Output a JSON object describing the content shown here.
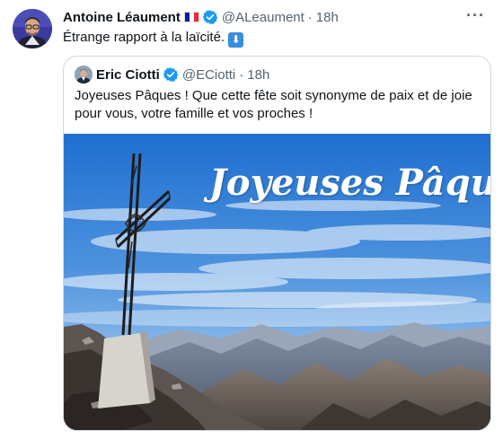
{
  "tweet": {
    "author_name": "Antoine Léaument",
    "author_handle": "@ALeaument",
    "separator": "·",
    "time": "18h",
    "text": "Étrange rapport à la laïcité.",
    "more_label": "···",
    "avatar_icon": "avatar-man-glasses",
    "flag_icon": "flag-france",
    "verified_icon": "verified-badge",
    "emoji_icon": "down-arrow-emoji",
    "emoji_glyph": "⬇"
  },
  "quote": {
    "author_name": "Eric Ciotti",
    "author_handle": "@ECiotti",
    "separator": "·",
    "time": "18h",
    "text": "Joyeuses Pâques ! Que cette fête soit synonyme de paix et de joie pour vous, votre famille et vos proches !",
    "avatar_icon": "avatar-man-suit",
    "verified_icon": "verified-badge",
    "media": {
      "overlay_text": "Joyeuses Pâques !",
      "description_icon": "mountain-cross-photo"
    }
  },
  "colors": {
    "verified_blue": "#1d9bf0",
    "text_primary": "#0f1419",
    "text_secondary": "#536471",
    "border": "#cfd9de",
    "flag_blue": "#002395",
    "flag_white": "#ffffff",
    "flag_red": "#ed2939"
  }
}
